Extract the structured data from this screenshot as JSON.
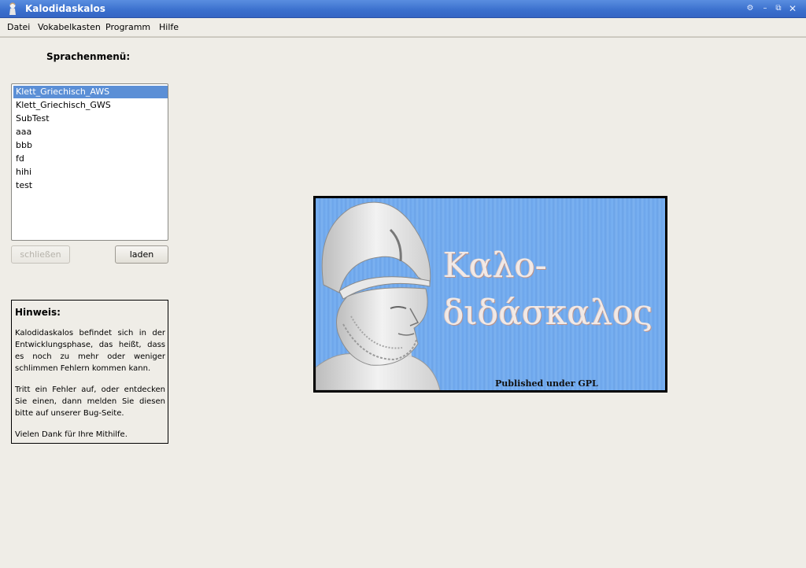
{
  "window": {
    "title": "Kalodidaskalos"
  },
  "menu": [
    {
      "label": "Datei"
    },
    {
      "label": "Vokabelkasten"
    },
    {
      "label": "Programm"
    },
    {
      "label": "Hilfe"
    }
  ],
  "language_menu": {
    "title": "Sprachenmenü:",
    "items": [
      "Klett_Griechisch_AWS",
      "Klett_Griechisch_GWS",
      "SubTest",
      "aaa",
      "bbb",
      "fd",
      "hihi",
      "test"
    ],
    "selected": "Klett_Griechisch_AWS",
    "close_label": "schließen",
    "load_label": "laden"
  },
  "hint": {
    "title": "Hinweis:",
    "paragraphs": [
      "Kalodidaskalos befindet sich in der Entwicklungsphase, das heißt, dass es noch zu mehr oder weniger schlimmen Fehlern kommen kann.",
      "Tritt ein Fehler auf, oder entdecken Sie einen, dann melden Sie diesen bitte auf unserer Bug-Seite.",
      "Vielen Dank für Ihre Mithilfe."
    ]
  },
  "splash": {
    "line1": "Καλο-",
    "line2": "διδάσκαλος",
    "footer": "Published under GPL"
  },
  "colors": {
    "titlebar": "#3a6fcd",
    "selection": "#5b8fd6",
    "splash_bg": "#6ea7ec"
  }
}
